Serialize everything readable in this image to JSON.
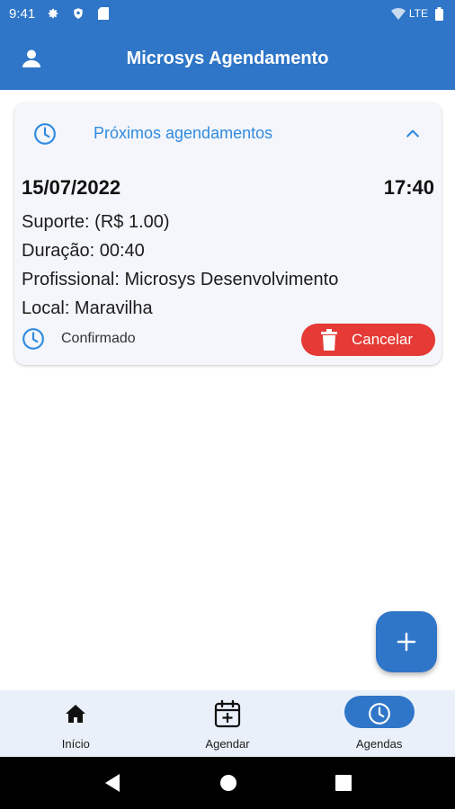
{
  "status_bar": {
    "time": "9:41",
    "network": "LTE"
  },
  "app_bar": {
    "title": "Microsys Agendamento"
  },
  "card": {
    "header_title": "Próximos agendamentos",
    "date": "15/07/2022",
    "time": "17:40",
    "service": "Suporte: (R$ 1.00)",
    "duration": "Duração: 00:40",
    "professional": "Profissional: Microsys Desenvolvimento",
    "location": "Local: Maravilha",
    "status": "Confirmado",
    "cancel_label": "Cancelar"
  },
  "bottom_nav": {
    "items": [
      {
        "label": "Início",
        "icon": "home-icon"
      },
      {
        "label": "Agendar",
        "icon": "calendar-plus-icon"
      },
      {
        "label": "Agendas",
        "icon": "clock-icon",
        "active": true
      }
    ]
  },
  "colors": {
    "primary": "#2f76c8",
    "accent_text": "#2f8be0",
    "danger": "#e53a35",
    "card_bg": "#f4f6fb",
    "nav_bg": "#eaf0f9"
  }
}
